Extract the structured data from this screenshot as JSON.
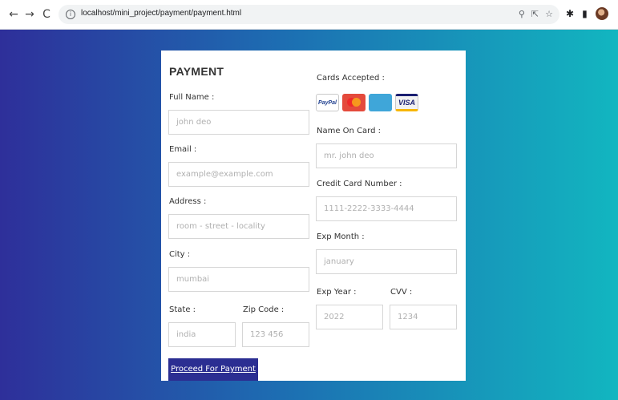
{
  "browser": {
    "url": "localhost/mini_project/payment/payment.html",
    "nav": {
      "back": "←",
      "forward": "→",
      "reload": "C"
    }
  },
  "form": {
    "title": "PAYMENT",
    "full_name": {
      "label": "Full Name :",
      "placeholder": "john deo"
    },
    "email": {
      "label": "Email :",
      "placeholder": "example@example.com"
    },
    "address": {
      "label": "Address :",
      "placeholder": "room - street - locality"
    },
    "city": {
      "label": "City :",
      "placeholder": "mumbai"
    },
    "state": {
      "label": "State :",
      "placeholder": "india"
    },
    "zip": {
      "label": "Zip Code :",
      "placeholder": "123 456"
    },
    "cards_accepted": {
      "label": "Cards Accepted :",
      "cards": [
        "PayPal",
        "MasterCard",
        "AMERICAN EXPRESS",
        "VISA"
      ]
    },
    "name_on_card": {
      "label": "Name On Card :",
      "placeholder": "mr. john deo"
    },
    "card_number": {
      "label": "Credit Card Number :",
      "placeholder": "1111-2222-3333-4444"
    },
    "exp_month": {
      "label": "Exp Month :",
      "placeholder": "january"
    },
    "exp_year": {
      "label": "Exp Year :",
      "placeholder": "2022"
    },
    "cvv": {
      "label": "CVV :",
      "placeholder": "1234"
    },
    "submit_label": "Proceed For Payment"
  },
  "colors": {
    "gradient_start": "#2e2f9a",
    "gradient_end": "#12b6c0",
    "button": "#2b2e92"
  }
}
